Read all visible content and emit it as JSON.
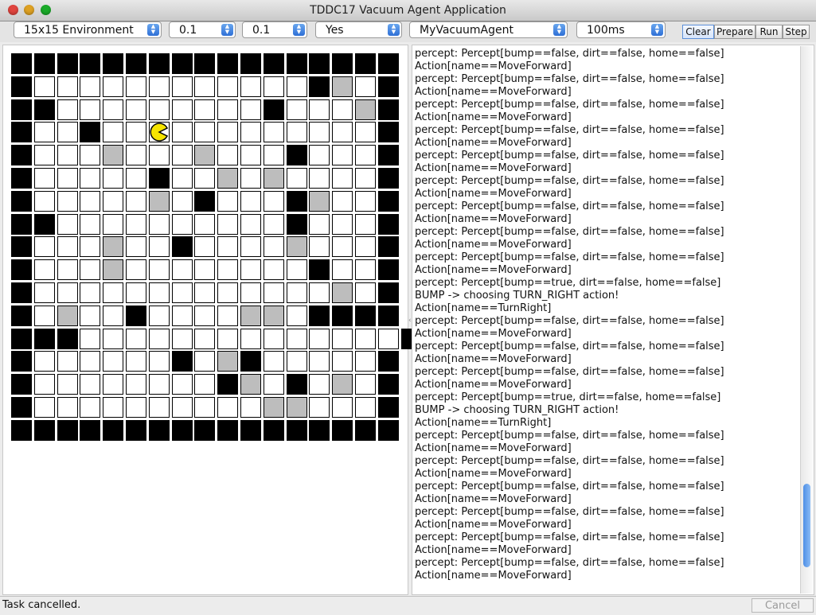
{
  "window": {
    "title": "TDDC17 Vacuum Agent Application"
  },
  "toolbar": {
    "environment": "15x15 Environment",
    "param1": "0.1",
    "param2": "0.1",
    "param3": "Yes",
    "agent": "MyVacuumAgent",
    "delay": "100ms",
    "clear_label": "Clear",
    "prepare_label": "Prepare",
    "run_label": "Run",
    "step_label": "Step"
  },
  "grid": {
    "rows": [
      "WWWWWWWWWWWWWWWWW",
      "W............WDOW",
      "WW.........W...DW",
      "W..W..A.........W",
      "W...D...D...W...W",
      "W.....W..D.D....W",
      "W.....D.W...WD..W",
      "WW..........W...W",
      "W...D..W....D...W",
      "W...D........W..W",
      "W.............D.W",
      "W.D..W....DD.WWWW",
      "WWW..............W",
      "W......W.DW.....W",
      "W........WD.W.D.W",
      "W..........DD...W",
      "WWWWWWWWWWWWWWWWW"
    ],
    "legend": {
      "W": "obstacle",
      "D": "dirt",
      ".": "clean",
      "A": "agent"
    },
    "agent_icon": "pacman-agent-icon"
  },
  "log": {
    "lines": [
      "percept: Percept[bump==false, dirt==false, home==false]",
      "Action[name==MoveForward]",
      "percept: Percept[bump==false, dirt==false, home==false]",
      "Action[name==MoveForward]",
      "percept: Percept[bump==false, dirt==false, home==false]",
      "Action[name==MoveForward]",
      "percept: Percept[bump==false, dirt==false, home==false]",
      "Action[name==MoveForward]",
      "percept: Percept[bump==false, dirt==false, home==false]",
      "Action[name==MoveForward]",
      "percept: Percept[bump==false, dirt==false, home==false]",
      "Action[name==MoveForward]",
      "percept: Percept[bump==false, dirt==false, home==false]",
      "Action[name==MoveForward]",
      "percept: Percept[bump==false, dirt==false, home==false]",
      "Action[name==MoveForward]",
      "percept: Percept[bump==false, dirt==false, home==false]",
      "Action[name==MoveForward]",
      "percept: Percept[bump==true, dirt==false, home==false]",
      "BUMP -> choosing TURN_RIGHT action!",
      "Action[name==TurnRight]",
      "percept: Percept[bump==false, dirt==false, home==false]",
      "Action[name==MoveForward]",
      "percept: Percept[bump==false, dirt==false, home==false]",
      "Action[name==MoveForward]",
      "percept: Percept[bump==false, dirt==false, home==false]",
      "Action[name==MoveForward]",
      "percept: Percept[bump==true, dirt==false, home==false]",
      "BUMP -> choosing TURN_RIGHT action!",
      "Action[name==TurnRight]",
      "percept: Percept[bump==false, dirt==false, home==false]",
      "Action[name==MoveForward]",
      "percept: Percept[bump==false, dirt==false, home==false]",
      "Action[name==MoveForward]",
      "percept: Percept[bump==false, dirt==false, home==false]",
      "Action[name==MoveForward]",
      "percept: Percept[bump==false, dirt==false, home==false]",
      "Action[name==MoveForward]",
      "percept: Percept[bump==false, dirt==false, home==false]",
      "Action[name==MoveForward]",
      "percept: Percept[bump==false, dirt==false, home==false]",
      "Action[name==MoveForward]"
    ]
  },
  "status": {
    "text": "Task cancelled.",
    "cancel_label": "Cancel"
  }
}
